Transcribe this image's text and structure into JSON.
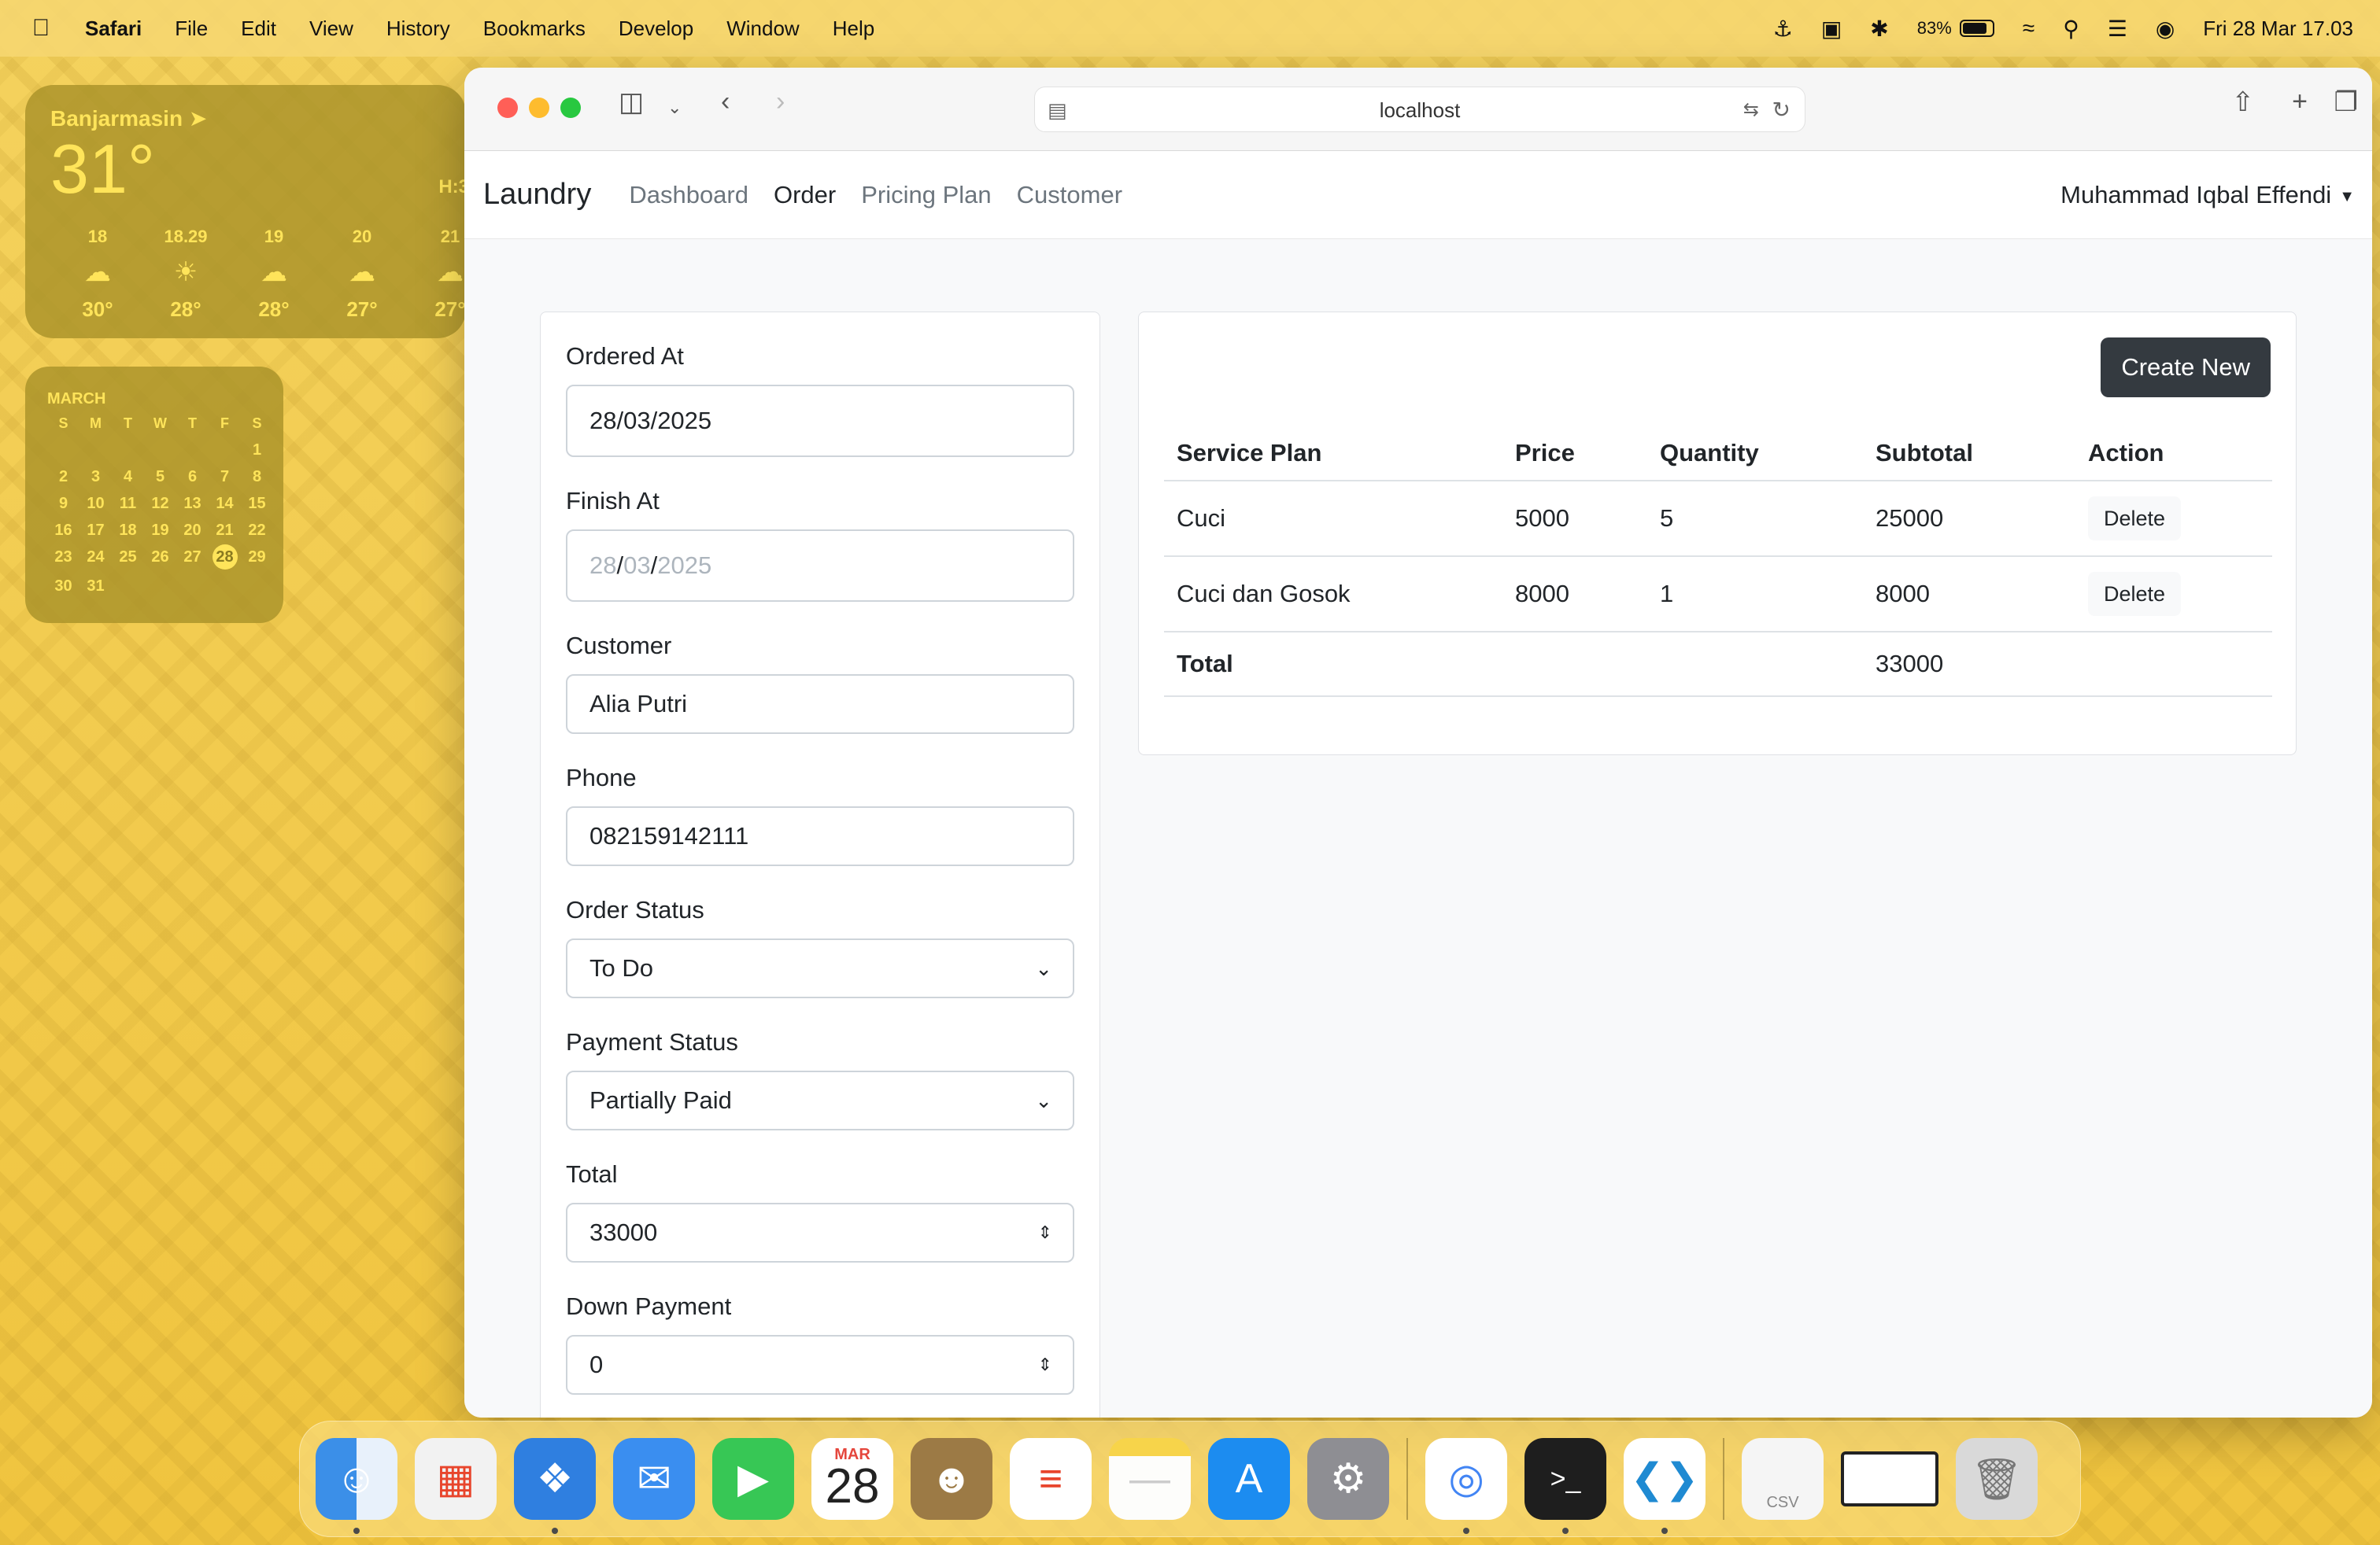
{
  "menubar": {
    "app_name": "Safari",
    "items": [
      "File",
      "Edit",
      "View",
      "History",
      "Bookmarks",
      "Develop",
      "Window",
      "Help"
    ],
    "battery": "83%",
    "battery_level": 0.83,
    "datetime": "Fri 28 Mar  17.03"
  },
  "weather": {
    "city": "Banjarmasin",
    "temp": "31°",
    "hl": "H:3",
    "hours": [
      {
        "time": "18",
        "icon": "cloud-icon",
        "temp": "30°"
      },
      {
        "time": "18.29",
        "icon": "sunset-icon",
        "temp": "28°"
      },
      {
        "time": "19",
        "icon": "cloud-icon",
        "temp": "28°"
      },
      {
        "time": "20",
        "icon": "cloud-icon",
        "temp": "27°"
      },
      {
        "time": "21",
        "icon": "cloud-icon",
        "temp": "27°"
      }
    ]
  },
  "calendar": {
    "month": "MARCH",
    "weekdays": [
      "S",
      "M",
      "T",
      "W",
      "T",
      "F",
      "S"
    ],
    "days": [
      "",
      "",
      "",
      "",
      "",
      "",
      "1",
      "2",
      "3",
      "4",
      "5",
      "6",
      "7",
      "8",
      "9",
      "10",
      "11",
      "12",
      "13",
      "14",
      "15",
      "16",
      "17",
      "18",
      "19",
      "20",
      "21",
      "22",
      "23",
      "24",
      "25",
      "26",
      "27",
      "28",
      "29",
      "30",
      "31"
    ],
    "today": "28"
  },
  "browser": {
    "url": "localhost"
  },
  "navbar": {
    "brand": "Laundry",
    "links": [
      {
        "label": "Dashboard",
        "active": false
      },
      {
        "label": "Order",
        "active": true
      },
      {
        "label": "Pricing Plan",
        "active": false
      },
      {
        "label": "Customer",
        "active": false
      }
    ],
    "user": "Muhammad Iqbal Effendi"
  },
  "form": {
    "ordered_at": {
      "label": "Ordered At",
      "value": "28/03/2025"
    },
    "finish_at": {
      "label": "Finish At",
      "day": "28",
      "month": "03",
      "year": "2025"
    },
    "customer": {
      "label": "Customer",
      "value": "Alia Putri"
    },
    "phone": {
      "label": "Phone",
      "value": "082159142111"
    },
    "order_status": {
      "label": "Order Status",
      "value": "To Do"
    },
    "payment_status": {
      "label": "Payment Status",
      "value": "Partially Paid"
    },
    "total": {
      "label": "Total",
      "value": "33000"
    },
    "down_payment": {
      "label": "Down Payment",
      "value": "0"
    }
  },
  "table": {
    "create_label": "Create New",
    "headers": [
      "Service Plan",
      "Price",
      "Quantity",
      "Subtotal",
      "Action"
    ],
    "rows": [
      {
        "plan": "Cuci",
        "price": "5000",
        "qty": "5",
        "subtotal": "25000",
        "action": "Delete"
      },
      {
        "plan": "Cuci dan Gosok",
        "price": "8000",
        "qty": "1",
        "subtotal": "8000",
        "action": "Delete"
      }
    ],
    "total_label": "Total",
    "total_value": "33000"
  },
  "dock": {
    "csv_label": "CSV",
    "calendar_month": "MAR",
    "calendar_day": "28"
  },
  "colors": {
    "desktop": "#f2c94c",
    "widget": "#ac942a",
    "primary_dark": "#343a40"
  }
}
